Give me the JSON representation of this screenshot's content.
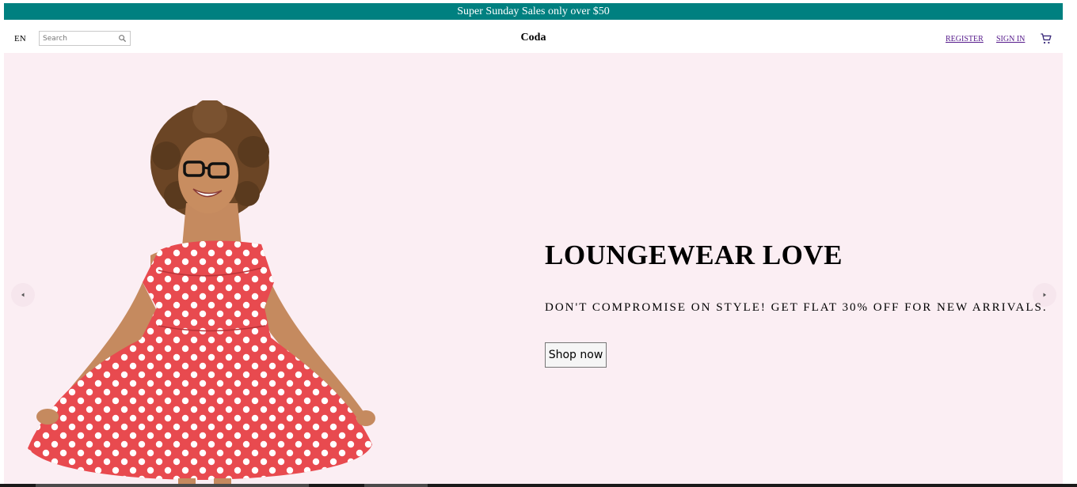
{
  "announcement": {
    "text": "Super Sunday Sales only over $50",
    "bg_color": "#008080"
  },
  "header": {
    "language": "EN",
    "search": {
      "placeholder": "Search",
      "value": ""
    },
    "brand": "Coda",
    "links": {
      "register": "REGISTER",
      "sign_in": "SIGN IN"
    },
    "icons": {
      "search": "search-icon",
      "cart": "shopping-cart-icon"
    },
    "link_color": "#551a8b"
  },
  "slider": {
    "bg_color": "#fbeef3",
    "title": "LOUNGEWEAR LOVE",
    "description": "DON'T COMPROMISE ON STYLE! GET FLAT 30% OFF FOR NEW ARRIVALS.",
    "button_label": "Shop now",
    "icons": {
      "prev": "arrow-left-icon",
      "next": "arrow-right-icon"
    },
    "image": "woman-in-red-polka-dot-dress",
    "dress_color": "#e84a4f"
  }
}
